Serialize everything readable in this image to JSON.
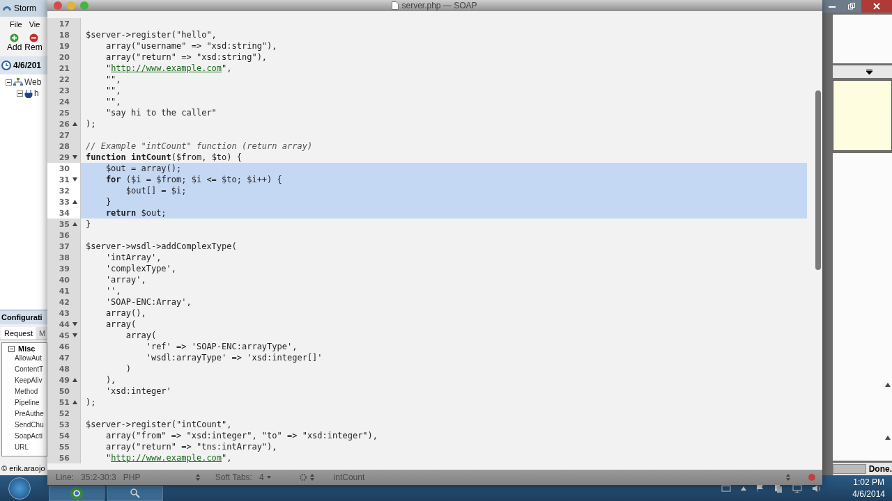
{
  "back_window": {
    "title": "Storm",
    "menu": [
      "File",
      "Vie"
    ],
    "toolbar": [
      {
        "label": "Add",
        "kind": "add"
      },
      {
        "label": "Rem",
        "kind": "remove"
      }
    ],
    "session_date": "4/6/201",
    "tree": [
      {
        "label": "Web",
        "expanded": true,
        "children": [
          {
            "label": "h",
            "expanded": true
          }
        ]
      }
    ],
    "config": {
      "title": "Configurati",
      "tabs": [
        {
          "label": "Request",
          "selected": true
        },
        {
          "label": "M",
          "selected": false
        }
      ],
      "group": {
        "label": "Misc",
        "expanded": true,
        "properties": [
          "AllowAut",
          "ContentT",
          "KeepAliv",
          "Method",
          "Pipeline",
          "PreAuthe",
          "SendChu",
          "SoapActi",
          "URL"
        ]
      }
    },
    "copyright": "© erik.araojo",
    "status": "Done."
  },
  "editor": {
    "title": "server.php — SOAP",
    "lines": [
      {
        "number": "17",
        "kind": "plain",
        "selected": false
      },
      {
        "number": "18",
        "kind": "plain",
        "code": "$server->register(\"hello\",",
        "selected": false
      },
      {
        "number": "19",
        "kind": "plain",
        "code": "    array(\"username\" => \"xsd:string\"),",
        "selected": false
      },
      {
        "number": "20",
        "kind": "plain",
        "code": "    array(\"return\" => \"xsd:string\"),",
        "selected": false
      },
      {
        "number": "21",
        "kind": "plain",
        "segments": [
          {
            "kind": "plain",
            "text": "    \""
          },
          {
            "kind": "link",
            "text": "http://www.example.com"
          },
          {
            "kind": "plain",
            "text": "\","
          }
        ],
        "selected": false
      },
      {
        "number": "22",
        "kind": "plain",
        "code": "    \"\",",
        "selected": false
      },
      {
        "number": "23",
        "kind": "plain",
        "code": "    \"\",",
        "selected": false
      },
      {
        "number": "24",
        "kind": "plain",
        "code": "    \"\",",
        "selected": false
      },
      {
        "number": "25",
        "kind": "plain",
        "code": "    \"say hi to the caller\"",
        "selected": false
      },
      {
        "number": "26",
        "kind": "closer",
        "code": ");",
        "selected": false
      },
      {
        "number": "27",
        "kind": "plain",
        "selected": false
      },
      {
        "number": "28",
        "kind": "plain",
        "segments": [
          {
            "kind": "comment",
            "text": "// Example \"intCount\" function (return array)"
          }
        ],
        "selected": false
      },
      {
        "number": "29",
        "kind": "opener",
        "segments": [
          {
            "kind": "keyword",
            "text": "function intCount"
          },
          {
            "kind": "plain",
            "text": "($from, $to) {"
          }
        ],
        "selected": false
      },
      {
        "number": "30",
        "kind": "plain",
        "code": "    $out = array();",
        "selected": true
      },
      {
        "number": "31",
        "kind": "opener",
        "segments": [
          {
            "kind": "keyword",
            "text": "    for"
          },
          {
            "kind": "plain",
            "text": " ($i = $from; $i <= $to; $i++) {"
          }
        ],
        "selected": true
      },
      {
        "number": "32",
        "kind": "plain",
        "code": "        $out[] = $i;",
        "selected": true
      },
      {
        "number": "33",
        "kind": "closer",
        "code": "    }",
        "selected": true
      },
      {
        "number": "34",
        "kind": "plain",
        "segments": [
          {
            "kind": "keyword",
            "text": "    return"
          },
          {
            "kind": "plain",
            "text": " $out;"
          }
        ],
        "selected": true
      },
      {
        "number": "35",
        "kind": "closer",
        "code": "}",
        "selected": false
      },
      {
        "number": "36",
        "kind": "plain",
        "selected": false
      },
      {
        "number": "37",
        "kind": "plain",
        "code": "$server->wsdl->addComplexType(",
        "selected": false
      },
      {
        "number": "38",
        "kind": "plain",
        "code": "    'intArray',",
        "selected": false
      },
      {
        "number": "39",
        "kind": "plain",
        "code": "    'complexType',",
        "selected": false
      },
      {
        "number": "40",
        "kind": "plain",
        "code": "    'array',",
        "selected": false
      },
      {
        "number": "41",
        "kind": "plain",
        "code": "    '',",
        "selected": false
      },
      {
        "number": "42",
        "kind": "plain",
        "code": "    'SOAP-ENC:Array',",
        "selected": false
      },
      {
        "number": "43",
        "kind": "plain",
        "code": "    array(),",
        "selected": false
      },
      {
        "number": "44",
        "kind": "opener",
        "code": "    array(",
        "selected": false
      },
      {
        "number": "45",
        "kind": "opener",
        "code": "        array(",
        "selected": false
      },
      {
        "number": "46",
        "kind": "plain",
        "code": "            'ref' => 'SOAP-ENC:arrayType',",
        "selected": false
      },
      {
        "number": "47",
        "kind": "plain",
        "code": "            'wsdl:arrayType' => 'xsd:integer[]'",
        "selected": false
      },
      {
        "number": "48",
        "kind": "plain",
        "code": "        )",
        "selected": false
      },
      {
        "number": "49",
        "kind": "closer",
        "code": "    ),",
        "selected": false
      },
      {
        "number": "50",
        "kind": "plain",
        "code": "    'xsd:integer'",
        "selected": false
      },
      {
        "number": "51",
        "kind": "closer",
        "code": ");",
        "selected": false
      },
      {
        "number": "52",
        "kind": "plain",
        "selected": false
      },
      {
        "number": "53",
        "kind": "plain",
        "code": "$server->register(\"intCount\",",
        "selected": false
      },
      {
        "number": "54",
        "kind": "plain",
        "code": "    array(\"from\" => \"xsd:integer\", \"to\" => \"xsd:integer\"),",
        "selected": false
      },
      {
        "number": "55",
        "kind": "plain",
        "code": "    array(\"return\" => \"tns:intArray\"),",
        "selected": false
      },
      {
        "number": "56",
        "kind": "plain",
        "segments": [
          {
            "kind": "plain",
            "text": "    \""
          },
          {
            "kind": "link",
            "text": "http://www.example.com"
          },
          {
            "kind": "plain",
            "text": "\","
          }
        ],
        "selected": false
      }
    ],
    "status": {
      "line_label": "Line:",
      "position": "35:2-30:3",
      "language": "PHP",
      "tabs_label": "Soft Tabs:",
      "tab_size": "4",
      "symbol": "intCount"
    }
  },
  "taskbar": {
    "time": "1:02 PM",
    "date": "4/6/2014"
  }
}
